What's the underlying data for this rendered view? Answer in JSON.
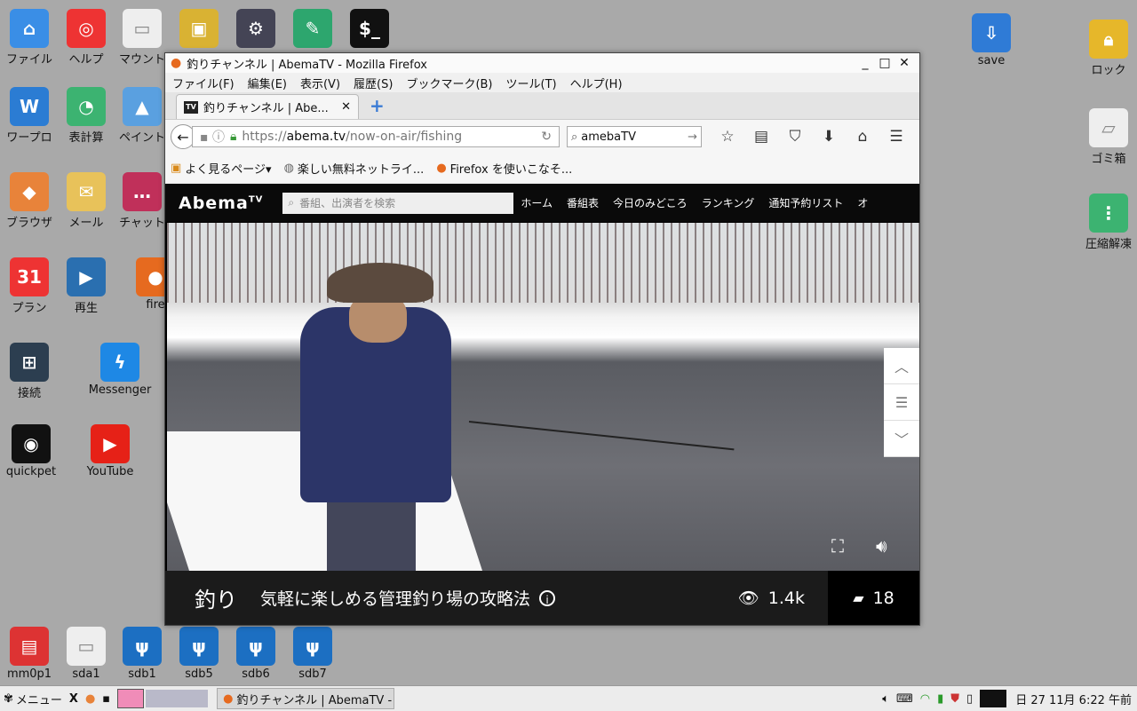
{
  "desktop": {
    "left_icons": [
      {
        "label": "ファイル",
        "icon": "home-icon",
        "color": "#3a8ee6"
      },
      {
        "label": "ヘルプ",
        "icon": "lifebuoy-icon",
        "color": "#e33"
      },
      {
        "label": "マウント",
        "icon": "drive-icon",
        "color": "#eee"
      },
      {
        "label": "",
        "icon": "package-icon",
        "color": "#d9b233"
      },
      {
        "label": "",
        "icon": "gear-icon",
        "color": "#445"
      },
      {
        "label": "",
        "icon": "pen-icon",
        "color": "#2da66e"
      },
      {
        "label": "",
        "icon": "terminal-icon",
        "color": "#111"
      },
      {
        "label": "ワープロ",
        "icon": "word-icon",
        "color": "#2b7cd3"
      },
      {
        "label": "表計算",
        "icon": "spreadsheet-icon",
        "color": "#3cb371"
      },
      {
        "label": "ペイント",
        "icon": "paint-icon",
        "color": "#5aa0e0"
      },
      {
        "label": "ブラウザ",
        "icon": "browser-fox-icon",
        "color": "#e8833a"
      },
      {
        "label": "メール",
        "icon": "mail-icon",
        "color": "#e8c25a"
      },
      {
        "label": "チャット",
        "icon": "chat-icon",
        "color": "#c0305a"
      },
      {
        "label": "プラン",
        "icon": "calendar-icon",
        "color": "#e33"
      },
      {
        "label": "再生",
        "icon": "video-icon",
        "color": "#2a6fb0"
      },
      {
        "label": "fire",
        "icon": "firefox-icon",
        "color": "#e66a1f"
      },
      {
        "label": "接続",
        "icon": "network-icon",
        "color": "#2c3e50"
      },
      {
        "label": "Messenger",
        "icon": "messenger-icon",
        "color": "#1e88e5"
      },
      {
        "label": "quickpet",
        "icon": "pet-icon",
        "color": "#111"
      },
      {
        "label": "YouTube",
        "icon": "youtube-icon",
        "color": "#e62117"
      },
      {
        "label": "mm0p1",
        "icon": "sdcard-icon",
        "color": "#d33"
      },
      {
        "label": "sda1",
        "icon": "drive-icon",
        "color": "#eee"
      },
      {
        "label": "sdb1",
        "icon": "usb-icon",
        "color": "#1c6fc2"
      },
      {
        "label": "sdb5",
        "icon": "usb-icon",
        "color": "#1c6fc2"
      },
      {
        "label": "sdb6",
        "icon": "usb-icon",
        "color": "#1c6fc2"
      },
      {
        "label": "sdb7",
        "icon": "usb-icon",
        "color": "#1c6fc2"
      }
    ],
    "right_icons": [
      {
        "label": "save",
        "icon": "download-icon",
        "color": "#2f7bd6"
      },
      {
        "label": "ロック",
        "icon": "lock-icon",
        "color": "#e6b72a"
      },
      {
        "label": "ゴミ箱",
        "icon": "trash-icon",
        "color": "#eee"
      },
      {
        "label": "圧縮解凍",
        "icon": "archive-icon",
        "color": "#3cb371"
      }
    ]
  },
  "window": {
    "title": "釣りチャンネル | AbemaTV - Mozilla Firefox",
    "menu": [
      "ファイル(F)",
      "編集(E)",
      "表示(V)",
      "履歴(S)",
      "ブックマーク(B)",
      "ツール(T)",
      "ヘルプ(H)"
    ],
    "tab_title": "釣りチャンネル | Abe...",
    "tab_favicon": "TV",
    "url_prefix": "https://",
    "url_host": "abema.tv",
    "url_path": "/now-on-air/fishing",
    "search_value": "amebaTV",
    "bookmarks": [
      {
        "label": "よく見るページ▾",
        "icon": "star-folder-icon"
      },
      {
        "label": "楽しい無料ネットライ...",
        "icon": "globe-icon"
      },
      {
        "label": "Firefox を使いこなそ...",
        "icon": "firefox-icon"
      }
    ]
  },
  "abema": {
    "logo": "Abema",
    "logo_sup": "TV",
    "search_placeholder": "番組、出演者を検索",
    "nav": [
      "ホーム",
      "番組表",
      "今日のみどころ",
      "ランキング",
      "通知予約リスト",
      "オ"
    ],
    "channel": "釣り",
    "program_title": "気軽に楽しめる管理釣り場の攻略法",
    "info_glyph": "i",
    "views": "1.4k",
    "comments": "18"
  },
  "taskbar": {
    "menu_label": "メニュー",
    "task_title": "釣りチャンネル | AbemaTV -",
    "clock": "日 27 11月   6:22 午前"
  }
}
